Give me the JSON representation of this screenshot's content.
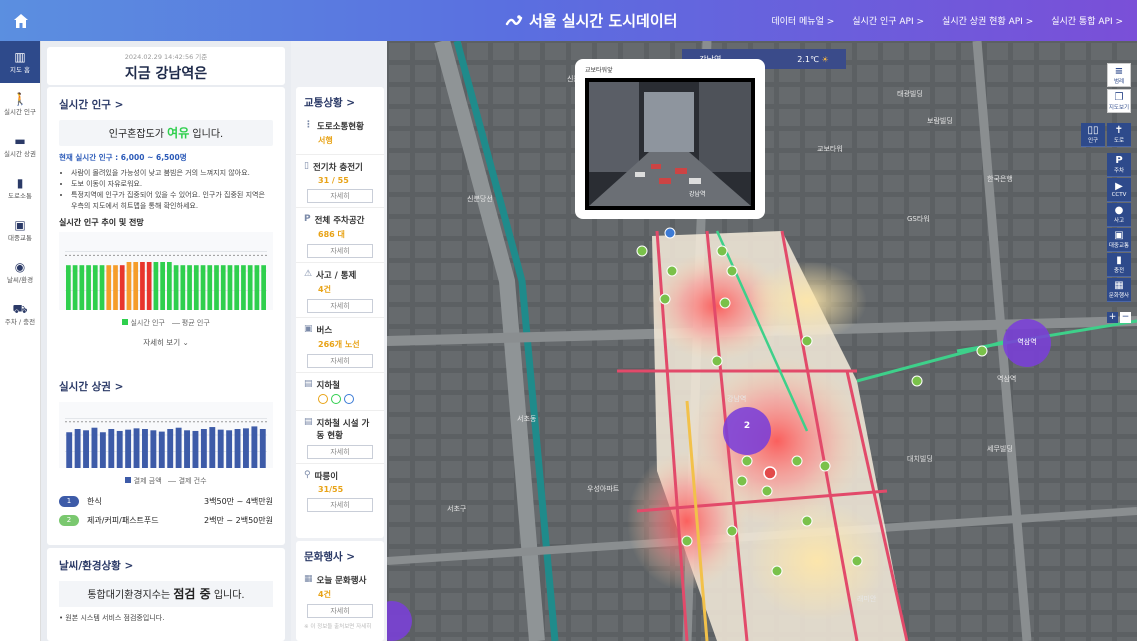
{
  "header": {
    "brand": "서울 실시간 도시데이터",
    "nav": [
      "데이터 메뉴얼 >",
      "실시간 인구 API >",
      "실시간 상권 현황 API >",
      "실시간 통합 API >"
    ]
  },
  "leftnav": [
    {
      "icon": "map-icon",
      "label": "지도 홈",
      "active": true
    },
    {
      "icon": "person-icon",
      "label": "실시간 인구"
    },
    {
      "icon": "card-icon",
      "label": "실시간 상권"
    },
    {
      "icon": "traffic-light-icon",
      "label": "도로소통"
    },
    {
      "icon": "bus-icon",
      "label": "대중교통"
    },
    {
      "icon": "globe-icon",
      "label": "날씨/환경"
    },
    {
      "icon": "car-icon",
      "label": "주차 / 충전"
    }
  ],
  "place": {
    "timestamp": "2024.02.29 14:42:56 기준",
    "name": "지금 강남역은"
  },
  "population": {
    "title": "실시간 인구 >",
    "congestion_pre": "인구혼잡도가 ",
    "congestion_value": "여유",
    "congestion_post": " 입니다.",
    "current": "현재 실시간 인구 : 6,000 ~ 6,500명",
    "notes": [
      "사람이 몰려있을 가능성이 낮고 붐빔은 거의 느껴지지 않아요.",
      "도보 이동이 자유로워요.",
      "특정지역에 인구가 집중되어 있을 수 있어요. 인구가 집중된 지역은 우측의 지도에서 히트맵을 통해 확인하세요."
    ],
    "trend_title": "실시간 인구 추이 및 전망",
    "legend": [
      "실시간 인구",
      "평균 인구"
    ],
    "more": "자세히 보기 ⌄",
    "colors": {
      "green": "#2fcf4d",
      "orange": "#f59d2a",
      "red": "#e8352c"
    }
  },
  "population_chart": {
    "type": "bar",
    "values": [
      14,
      14,
      14,
      14,
      14,
      14,
      14,
      14,
      14,
      15,
      15,
      15,
      15,
      15,
      15,
      15,
      14,
      14,
      14,
      14,
      14,
      14,
      14,
      14,
      14,
      14,
      14,
      14,
      14,
      14
    ],
    "status": [
      "g",
      "g",
      "g",
      "g",
      "g",
      "g",
      "o",
      "o",
      "r",
      "o",
      "o",
      "r",
      "r",
      "g",
      "g",
      "g",
      "g",
      "g",
      "g",
      "g",
      "g",
      "g",
      "g",
      "g",
      "g",
      "g",
      "g",
      "g",
      "g",
      "g"
    ]
  },
  "commerce": {
    "title": "실시간 상권 >",
    "legend": [
      "결제 금액",
      "결제 건수"
    ],
    "ranks": [
      {
        "no": "1",
        "cat": "한식",
        "amount": "3백50만 ~ 4백만원"
      },
      {
        "no": "2",
        "cat": "제과/커피/패스트푸드",
        "amount": "2백만 ~ 2백50만원"
      }
    ]
  },
  "commerce_chart": {
    "type": "bar",
    "values": [
      55,
      60,
      58,
      62,
      55,
      60,
      57,
      59,
      61,
      60,
      58,
      56,
      60,
      62,
      58,
      57,
      60,
      63,
      59,
      58,
      60,
      61,
      64,
      60
    ]
  },
  "weather": {
    "title": "날씨/환경상황 >",
    "pre": "통합대기환경지수는 ",
    "value": "점검 중",
    "post": " 입니다.",
    "note": "원본 시스템 서비스 점검중입니다."
  },
  "traffic": {
    "title": "교통상황 >",
    "items": [
      {
        "icon": "traffic-light-icon",
        "label": "도로소통현황",
        "value": "서행",
        "detail": false
      },
      {
        "icon": "charger-icon",
        "label": "전기차 충전기",
        "value": "31 / 55",
        "detail": true,
        "gray": true
      },
      {
        "icon": "parking-icon",
        "label": "전체 주차공간",
        "value": "686 대",
        "detail": true
      },
      {
        "icon": "accident-icon",
        "label": "사고 / 통제",
        "value": "4건",
        "detail": true
      },
      {
        "icon": "bus-icon",
        "label": "버스",
        "value": "266개 노선",
        "detail": true
      },
      {
        "icon": "subway-icon",
        "label": "지하철",
        "value": "",
        "detail": false
      },
      {
        "icon": "subway-facility-icon",
        "label": "지하철 시설 가동 현황",
        "value": "",
        "detail": true
      },
      {
        "icon": "bike-icon",
        "label": "따릉이",
        "value": "31/55",
        "detail": true
      }
    ],
    "detail": "자세히"
  },
  "culture": {
    "title": "문화행사 >",
    "item": "오늘 문화행사",
    "value": "4건",
    "detail": "자세히",
    "footnote": "※ 이 정보들 출처보면 자세히"
  },
  "map": {
    "location_select": "강남역",
    "temperature": "2.1℃",
    "cctv_title": "교보타워앞",
    "cctv_caption": "강남역",
    "cluster_labels": [
      "2",
      "역삼역",
      "2"
    ],
    "tools": [
      {
        "icon": "layer-icon",
        "label": "범례"
      },
      {
        "icon": "copy-icon",
        "label": "지도보기"
      },
      {
        "icon": "people-icon",
        "label": "인구"
      },
      {
        "icon": "traffic-icon",
        "label": "도로"
      },
      {
        "icon": "parking-icon",
        "label": "주차"
      },
      {
        "icon": "cctv-icon",
        "label": "CCTV"
      },
      {
        "icon": "accident-icon",
        "label": "사고"
      },
      {
        "icon": "bus-icon",
        "label": "대중교통"
      },
      {
        "icon": "charger-icon",
        "label": "충전"
      },
      {
        "icon": "calendar-icon",
        "label": "문화행사"
      }
    ],
    "labels": [
      "태광빌딩",
      "교보타워",
      "보람빌딩",
      "강남역",
      "역삼역",
      "서초동",
      "우성아파트",
      "GS타워",
      "한국은행",
      "신분당선",
      "대치빌딩",
      "서초구",
      "래미안",
      "세무빌딩",
      "신논현역"
    ]
  }
}
